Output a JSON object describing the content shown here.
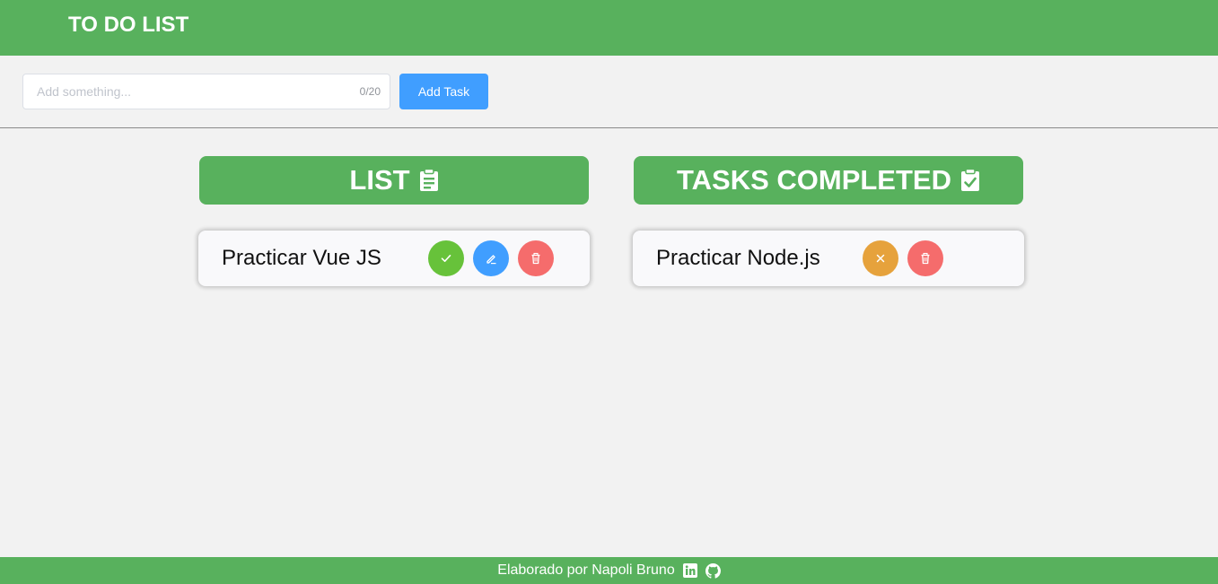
{
  "header": {
    "title": "TO DO LIST"
  },
  "task_input": {
    "placeholder": "Add something...",
    "value": "",
    "counter": "0/20"
  },
  "add_button": {
    "label": "Add Task"
  },
  "list_column": {
    "title": "LIST",
    "icon": "clipboard-list-icon",
    "tasks": [
      {
        "text": "Practicar Vue JS"
      }
    ]
  },
  "completed_column": {
    "title": "TASKS COMPLETED",
    "icon": "clipboard-check-icon",
    "tasks": [
      {
        "text": "Practicar Node.js"
      }
    ]
  },
  "footer": {
    "credit": "Elaborado por Napoli Bruno",
    "links": [
      "linkedin-icon",
      "github-icon"
    ]
  },
  "colors": {
    "brand_green": "#58b15d",
    "primary_blue": "#409eff",
    "success_green": "#67c23a",
    "warning_orange": "#e6a23c",
    "danger_red": "#f56c6c",
    "background": "#f2f2f2"
  }
}
